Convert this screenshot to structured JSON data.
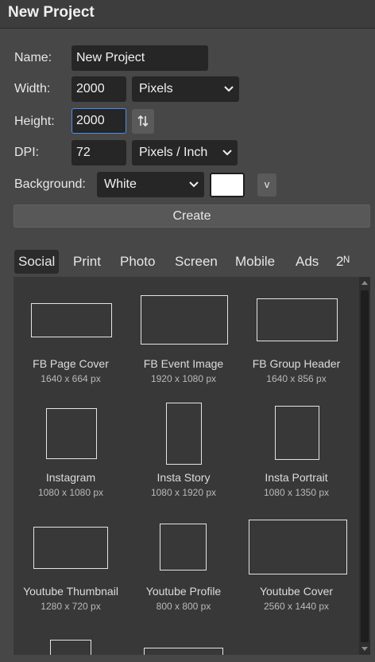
{
  "window": {
    "title": "New Project"
  },
  "form": {
    "name_label": "Name:",
    "name_value": "New Project",
    "width_label": "Width:",
    "width_value": "2000",
    "width_unit": "Pixels",
    "height_label": "Height:",
    "height_value": "2000",
    "dpi_label": "DPI:",
    "dpi_value": "72",
    "dpi_unit": "Pixels / Inch",
    "background_label": "Background:",
    "background_value": "White",
    "background_color": "#ffffff",
    "v_button_label": "v",
    "create_label": "Create"
  },
  "tabs": [
    {
      "label": "Social",
      "active": true
    },
    {
      "label": "Print"
    },
    {
      "label": "Photo"
    },
    {
      "label": "Screen"
    },
    {
      "label": "Mobile"
    },
    {
      "label": "Ads"
    },
    {
      "label": "2ᴺ"
    }
  ],
  "presets": [
    {
      "name": "FB Page Cover",
      "size": "1640 x 664 px"
    },
    {
      "name": "FB Event Image",
      "size": "1920 x 1080 px"
    },
    {
      "name": "FB Group Header",
      "size": "1640 x 856 px"
    },
    {
      "name": "Instagram",
      "size": "1080 x 1080 px"
    },
    {
      "name": "Insta Story",
      "size": "1080 x 1920 px"
    },
    {
      "name": "Insta Portrait",
      "size": "1080 x 1350 px"
    },
    {
      "name": "Youtube Thumbnail",
      "size": "1280 x 720 px"
    },
    {
      "name": "Youtube Profile",
      "size": "800 x 800 px"
    },
    {
      "name": "Youtube Cover",
      "size": "2560 x 1440 px"
    }
  ]
}
